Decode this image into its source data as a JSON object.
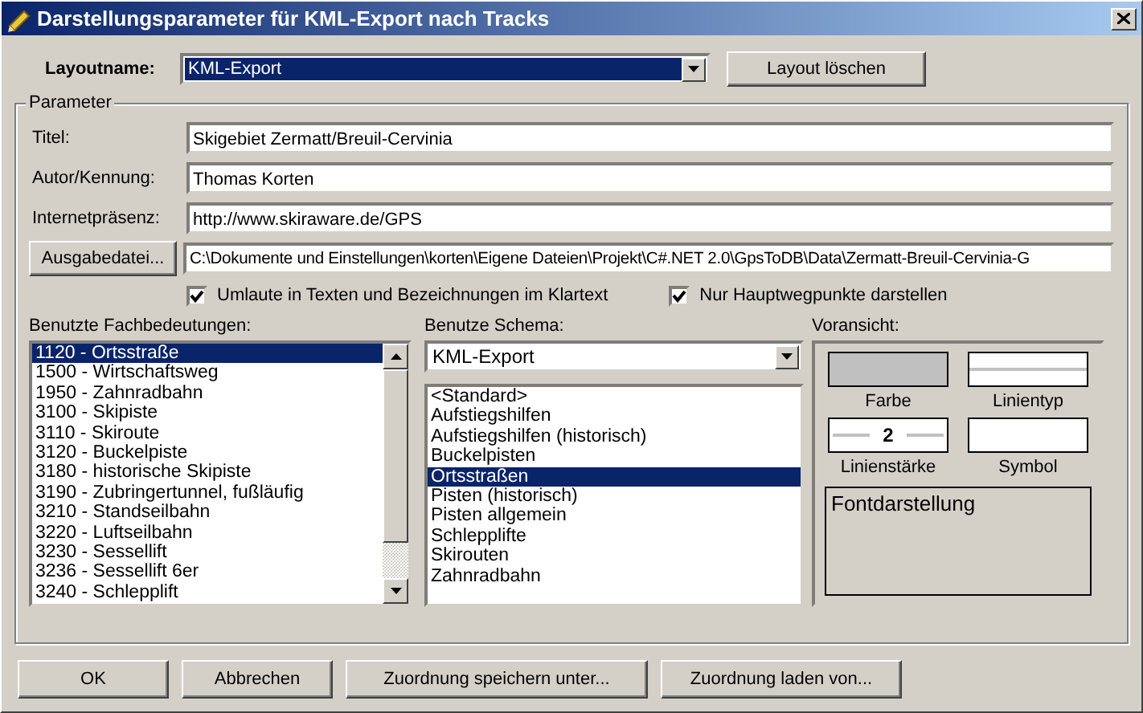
{
  "window": {
    "title": "Darstellungsparameter für KML-Export nach Tracks"
  },
  "layout": {
    "label": "Layoutname:",
    "value": "KML-Export",
    "button": "Layout löschen"
  },
  "parameter": {
    "legend": "Parameter",
    "fields": [
      {
        "label": "Titel:",
        "value": "Skigebiet Zermatt/Breuil-Cervinia"
      },
      {
        "label": "Autor/Kennung:",
        "value": "Thomas Korten"
      },
      {
        "label": "Internetpräsenz:",
        "value": "http://www.skiraware.de/GPS"
      }
    ],
    "output_button": "Ausgabedatei...",
    "output_path": "C:\\Dokumente und Einstellungen\\korten\\Eigene Dateien\\Projekt\\C#.NET 2.0\\GpsToDB\\Data\\Zermatt-Breuil-Cervinia-G",
    "checkboxes": [
      {
        "label": "Umlaute in Texten und Bezeichnungen im Klartext",
        "checked": true
      },
      {
        "label": "Nur Hauptwegpunkte darstellen",
        "checked": true
      }
    ],
    "meanings": {
      "label": "Benutzte Fachbedeutungen:",
      "items": [
        {
          "text": "1120 - Ortsstraße",
          "selected": true
        },
        {
          "text": "1500 - Wirtschaftsweg",
          "selected": false
        },
        {
          "text": "1950 - Zahnradbahn",
          "selected": false
        },
        {
          "text": "3100 - Skipiste",
          "selected": false
        },
        {
          "text": "3110 - Skiroute",
          "selected": false
        },
        {
          "text": "3120 - Buckelpiste",
          "selected": false
        },
        {
          "text": "3180 - historische Skipiste",
          "selected": false
        },
        {
          "text": "3190 - Zubringertunnel, fußläufig",
          "selected": false
        },
        {
          "text": "3210 - Standseilbahn",
          "selected": false
        },
        {
          "text": "3220 - Luftseilbahn",
          "selected": false
        },
        {
          "text": "3230 - Sessellift",
          "selected": false
        },
        {
          "text": "3236 - Sessellift 6er",
          "selected": false
        },
        {
          "text": "3240 - Schlepplift",
          "selected": false
        }
      ]
    },
    "schema": {
      "label": "Benutze Schema:",
      "value": "KML-Export",
      "items": [
        {
          "text": "<Standard>",
          "selected": false
        },
        {
          "text": "Aufstiegshilfen",
          "selected": false
        },
        {
          "text": "Aufstiegshilfen (historisch)",
          "selected": false
        },
        {
          "text": "Buckelpisten",
          "selected": false
        },
        {
          "text": "Ortsstraßen",
          "selected": true
        },
        {
          "text": "Pisten (historisch)",
          "selected": false
        },
        {
          "text": "Pisten allgemein",
          "selected": false
        },
        {
          "text": "Schlepplifte",
          "selected": false
        },
        {
          "text": "Skirouten",
          "selected": false
        },
        {
          "text": "Zahnradbahn",
          "selected": false
        }
      ]
    },
    "preview": {
      "label": "Voransicht:",
      "color_label": "Farbe",
      "linetype_label": "Linientyp",
      "width_value": "2",
      "width_label": "Linienstärke",
      "symbol_label": "Symbol",
      "font_label": "Fontdarstellung"
    }
  },
  "buttons": [
    "OK",
    "Abbrechen",
    "Zuordnung speichern unter...",
    "Zuordnung laden von..."
  ]
}
